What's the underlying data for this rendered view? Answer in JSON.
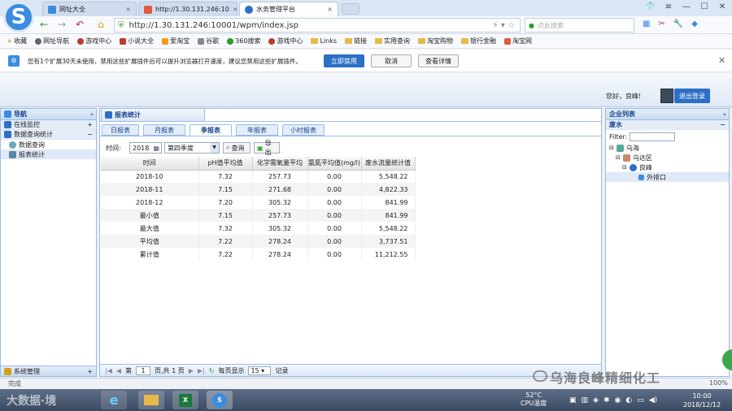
{
  "browser": {
    "tabs": [
      {
        "label": "网址大全"
      },
      {
        "label": "http://1.30.131.246:10"
      },
      {
        "label": "水务管理平台"
      }
    ],
    "url": "http://1.30.131.246:10001/wpm/index.jsp",
    "search_placeholder": "点此搜索",
    "bookmarks": [
      "收藏",
      "网址导航",
      "游戏中心",
      "小说大全",
      "爱淘宝",
      "谷歌",
      "360搜索",
      "游戏中心",
      "Links",
      "链接",
      "实用查询",
      "淘宝购物",
      "银行金融",
      "淘宝网"
    ]
  },
  "notify": {
    "text": "您有1个扩展30天未使用，禁用这些扩展插件后可以提升浏览器打开速度，建议您禁用这些扩展插件。",
    "btn_disable": "立即禁用",
    "btn_cancel": "取消",
    "btn_detail": "查看详情"
  },
  "header": {
    "greeting": "您好，良峰!",
    "logout": "退出登录"
  },
  "nav": {
    "title": "导航",
    "sections": [
      {
        "label": "在线监控"
      },
      {
        "label": "数据查询统计"
      }
    ],
    "items": [
      {
        "label": "数据查询"
      },
      {
        "label": "报表统计"
      }
    ],
    "bottom": "系统管理"
  },
  "main": {
    "panel_title": "报表统计",
    "tabs": [
      "日报表",
      "月报表",
      "季报表",
      "年报表",
      "小时报表"
    ],
    "toolbar": {
      "time_label": "时间:",
      "year": "2018",
      "quarter": "第四季度",
      "query": "查询",
      "export": "导出"
    },
    "columns": [
      "时间",
      "pH值平均值",
      "化学需氧量平均",
      "氨氮平均值(mg/l)",
      "废水流量统计值"
    ],
    "rows": [
      [
        "2018-10",
        "7.32",
        "257.73",
        "0.00",
        "5,548.22"
      ],
      [
        "2018-11",
        "7.15",
        "271.68",
        "0.00",
        "4,822.33"
      ],
      [
        "2018-12",
        "7.20",
        "305.32",
        "0.00",
        "841.99"
      ],
      [
        "最小值",
        "7.15",
        "257.73",
        "0.00",
        "841.99"
      ],
      [
        "最大值",
        "7.32",
        "305.32",
        "0.00",
        "5,548.22"
      ],
      [
        "平均值",
        "7.22",
        "278.24",
        "0.00",
        "3,737.51"
      ],
      [
        "累计值",
        "7.22",
        "278.24",
        "0.00",
        "11,212.55"
      ]
    ],
    "pager": {
      "page_prefix": "第",
      "page_no": "1",
      "page_suffix": "页,共 1 页",
      "per_page_label": "每页显示",
      "per_page": "15",
      "records": "记录"
    }
  },
  "right": {
    "title": "企业列表",
    "sub": "废水",
    "filter_label": "Filter:",
    "tree": [
      "乌海",
      "乌达区",
      "良峰",
      "外排口"
    ]
  },
  "status": {
    "done": "完成",
    "zoom": "100%"
  },
  "taskbar": {
    "cpu_temp": "52°C",
    "cpu_label": "CPU温度",
    "time": "10:00",
    "date": "2018/12/12"
  },
  "overlay": {
    "watermark": "乌海良峰精细化工",
    "watermark_left": "大数据·境"
  },
  "colors": {
    "accent": "#2b6fc6",
    "panel_border": "#99bbe8",
    "header_text": "#15428b"
  }
}
